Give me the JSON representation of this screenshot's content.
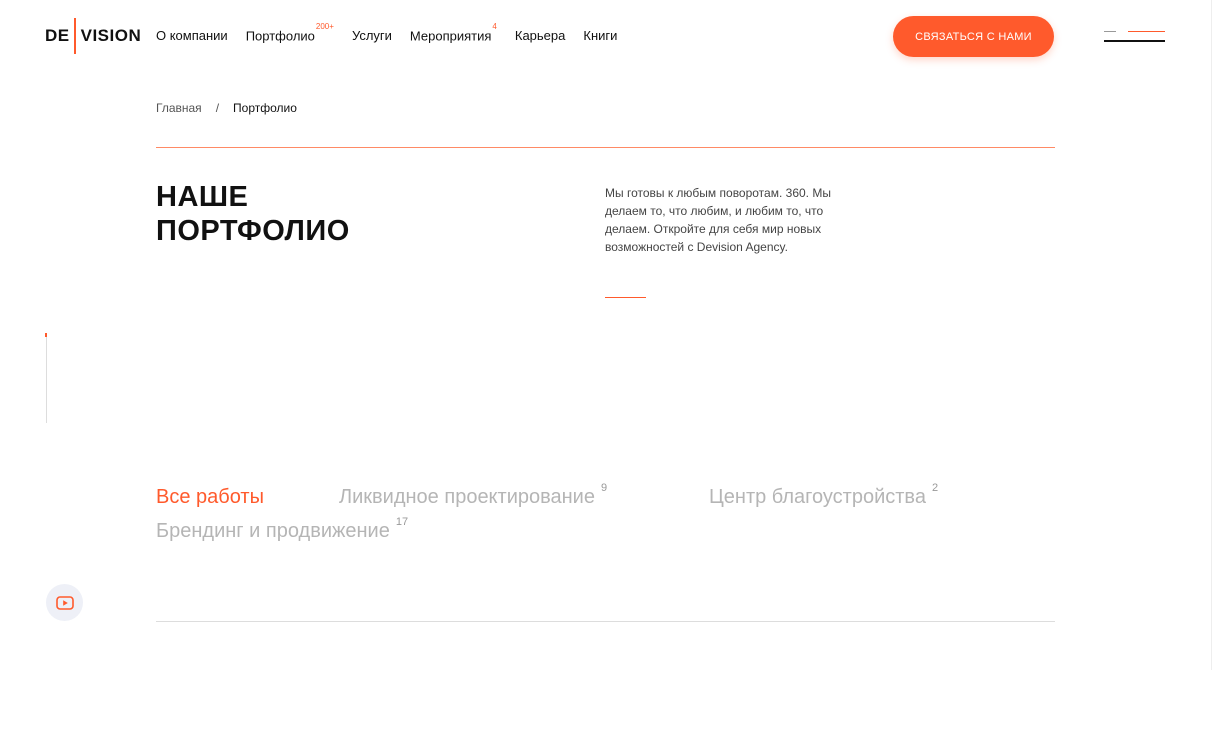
{
  "header": {
    "logo_left": "DE",
    "logo_right": "VISION",
    "nav": [
      {
        "label": "О компании",
        "badge": ""
      },
      {
        "label": "Портфолио",
        "badge": "200+"
      },
      {
        "label": "Услуги",
        "badge": ""
      },
      {
        "label": "Мероприятия",
        "badge": "4"
      },
      {
        "label": "Карьера",
        "badge": ""
      },
      {
        "label": "Книги",
        "badge": ""
      }
    ],
    "cta_label": "СВЯЗАТЬСЯ С НАМИ"
  },
  "breadcrumb": {
    "home": "Главная",
    "separator": "/",
    "current": "Портфолио"
  },
  "hero": {
    "title_line1": "НАШЕ",
    "title_line2": "ПОРТФОЛИО",
    "description": "Мы готовы к любым поворотам. 360. Мы делаем то, что любим, и любим то, что делаем. Откройте для себя мир новых возможностей с Devision Agency."
  },
  "filters": [
    {
      "label": "Все работы",
      "count": ""
    },
    {
      "label": "Ликвидное проектирование",
      "count": "9"
    },
    {
      "label": "Центр благоустройства",
      "count": "2"
    },
    {
      "label": "Брендинг и продвижение",
      "count": "17"
    }
  ],
  "colors": {
    "accent": "#ff5a2c",
    "text": "#111111",
    "muted": "#b5b5b5"
  },
  "icons": {
    "video": "youtube-play-icon",
    "menu": "hamburger-menu-icon"
  }
}
